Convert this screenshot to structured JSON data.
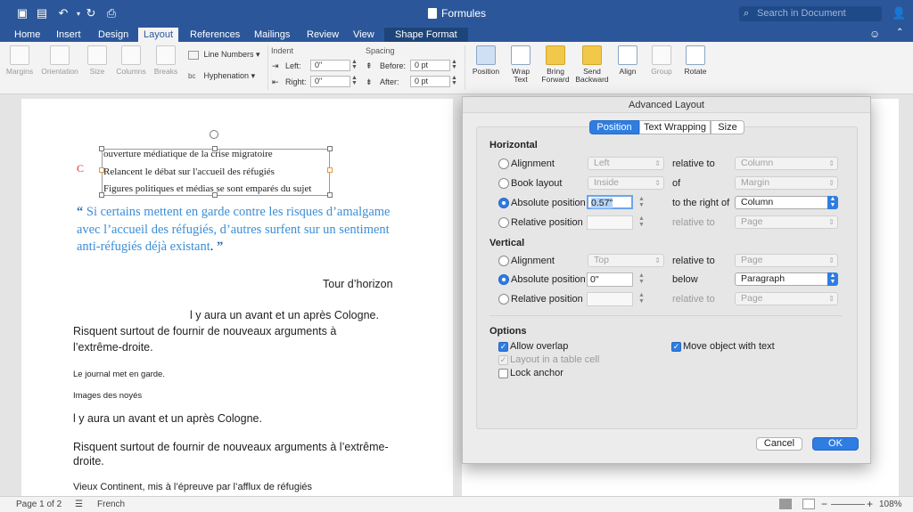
{
  "window": {
    "doc_title": "Formules",
    "search_placeholder": "Search in Document"
  },
  "tabs": [
    "Home",
    "Insert",
    "Design",
    "Layout",
    "References",
    "Mailings",
    "Review",
    "View",
    "Shape Format"
  ],
  "ribbon": {
    "margins": "Margins",
    "orientation": "Orientation",
    "size": "Size",
    "columns": "Columns",
    "breaks": "Breaks",
    "line_numbers": "Line Numbers",
    "hyphenation": "Hyphenation",
    "indent_title": "Indent",
    "left_label": "Left:",
    "right_label": "Right:",
    "left_value": "0\"",
    "right_value": "0\"",
    "spacing_title": "Spacing",
    "before_label": "Before:",
    "after_label": "After:",
    "before_value": "0 pt",
    "after_value": "0 pt",
    "position": "Position",
    "wrap_text_1": "Wrap",
    "wrap_text_2": "Text",
    "bring_forward_1": "Bring",
    "bring_forward_2": "Forward",
    "send_backward_1": "Send",
    "send_backward_2": "Backward",
    "align": "Align",
    "group": "Group",
    "rotate": "Rotate"
  },
  "document": {
    "textbox_lines": [
      "ouverture médiatique de la crise migratoire",
      "Relancent le débat sur l'accueil des réfugiés",
      "Figures politiques et médias se sont emparés du sujet"
    ],
    "red_c": "C",
    "quote_open": "“",
    "quote_text": "Si certains mettent en garde contre les risques d’amalgame avec l’accueil des réfugiés, d’autres surfent sur un sentiment anti-réfugiés déjà existant",
    "quote_end_dot": ".",
    "quote_close": "”",
    "tour": "Tour d’horizon",
    "line1": "l y aura un avant et un après Cologne.",
    "line2": "Risquent surtout de fournir de nouveaux arguments à",
    "line3": "l’extrême-droite.",
    "line4": "Le journal met en garde.",
    "line5": "Images des noyés",
    "line6": "l y aura un avant et un après Cologne.",
    "line7": "Risquent surtout de fournir de nouveaux arguments à l’extrême-",
    "line8": "droite.",
    "line9": "Vieux Continent, mis à l’épreuve par l’afflux de réfugiés"
  },
  "dialog": {
    "title": "Advanced Layout",
    "tabs": [
      "Position",
      "Text Wrapping",
      "Size"
    ],
    "horizontal": {
      "title": "Horizontal",
      "alignment": "Alignment",
      "alignment_value": "Left",
      "relative_to": "relative to",
      "alignment_rel": "Column",
      "book_layout": "Book layout",
      "book_value": "Inside",
      "of": "of",
      "book_rel": "Margin",
      "absolute_position": "Absolute position",
      "abs_value": "0.57\"",
      "to_the_right_of": "to the right of",
      "abs_rel": "Column",
      "relative_position": "Relative position",
      "relpos_rel": "Page"
    },
    "vertical": {
      "title": "Vertical",
      "alignment": "Alignment",
      "alignment_value": "Top",
      "relative_to": "relative to",
      "alignment_rel": "Page",
      "absolute_position": "Absolute position",
      "abs_value": "0\"",
      "below": "below",
      "abs_rel": "Paragraph",
      "relative_position": "Relative position",
      "relpos_rel": "Page"
    },
    "options": {
      "title": "Options",
      "allow_overlap": "Allow overlap",
      "layout_in_table_cell": "Layout in a table cell",
      "lock_anchor": "Lock anchor",
      "move_object_with_text": "Move object with text"
    },
    "cancel": "Cancel",
    "ok": "OK"
  },
  "statusbar": {
    "page": "Page 1 of 2",
    "language": "French",
    "zoom": "108%"
  },
  "colors": {
    "accent": "#2b579a",
    "dialog_blue": "#2f7de1",
    "quote_blue": "#3b8ed6"
  }
}
